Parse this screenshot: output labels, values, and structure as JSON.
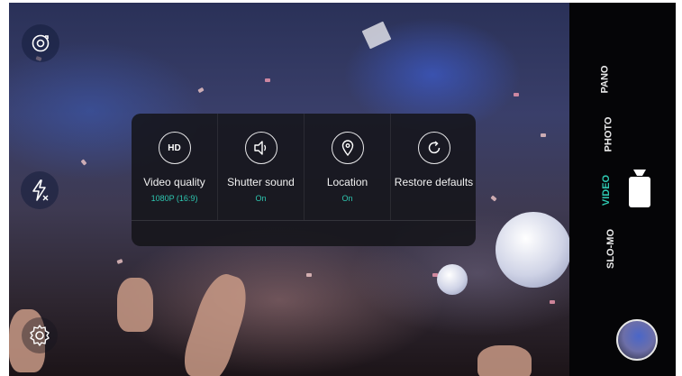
{
  "settings": [
    {
      "icon": "hd-icon",
      "badge": "HD",
      "label": "Video quality",
      "value": "1080P (16:9)"
    },
    {
      "icon": "speaker-icon",
      "label": "Shutter sound",
      "value": "On"
    },
    {
      "icon": "location-pin-icon",
      "label": "Location",
      "value": "On"
    },
    {
      "icon": "restore-icon",
      "label": "Restore defaults",
      "value": ""
    }
  ],
  "modes": [
    "PANO",
    "PHOTO",
    "VIDEO",
    "SLO-MO"
  ],
  "active_mode": "VIDEO",
  "colors": {
    "accent": "#2ec7b0",
    "panel": "#141418",
    "mode_bar": "#050507"
  }
}
